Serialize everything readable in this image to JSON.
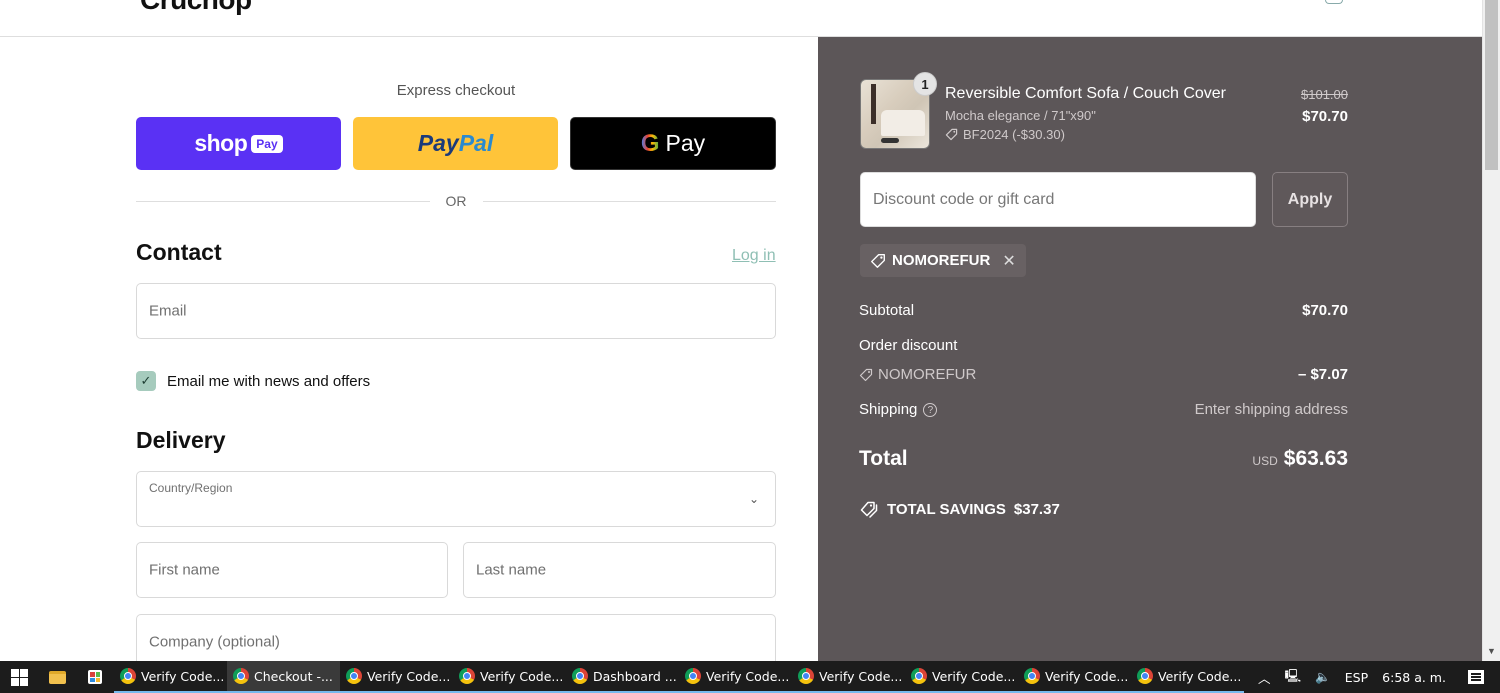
{
  "header": {
    "store_logo": "Cruchop"
  },
  "express_checkout": {
    "title": "Express checkout",
    "shop_pay": {
      "shop": "shop",
      "pay": "Pay"
    },
    "paypal": {
      "part1": "Pay",
      "part2": "Pal"
    },
    "gpay": {
      "g": "G",
      "pay": "Pay"
    },
    "divider": "OR"
  },
  "contact": {
    "title": "Contact",
    "login_link": "Log in",
    "email_placeholder": "Email",
    "newsletter_label": "Email me with news and offers",
    "newsletter_checked": true
  },
  "delivery": {
    "title": "Delivery",
    "country_label": "Country/Region",
    "country_value": "",
    "first_name_placeholder": "First name",
    "last_name_placeholder": "Last name",
    "company_placeholder": "Company (optional)"
  },
  "order_summary": {
    "product": {
      "quantity": "1",
      "name": "Reversible Comfort Sofa / Couch Cover",
      "variant": "Mocha elegance / 71\"x90\"",
      "discount": "BF2024 (-$30.30)",
      "original_price": "$101.00",
      "price": "$70.70"
    },
    "discount_placeholder": "Discount code or gift card",
    "apply_label": "Apply",
    "applied_code": "NOMOREFUR",
    "subtotal_label": "Subtotal",
    "subtotal_value": "$70.70",
    "order_discount_label": "Order discount",
    "order_discount_code": "NOMOREFUR",
    "order_discount_value": "– $7.07",
    "shipping_label": "Shipping",
    "shipping_value": "Enter shipping address",
    "total_label": "Total",
    "currency": "USD",
    "total_value": "$63.63",
    "savings_label": "TOTAL SAVINGS",
    "savings_value": "$37.37",
    "colors": {
      "panel_bg": "#5c5658",
      "accent_checkbox": "#a6cbbd"
    }
  },
  "taskbar": {
    "apps": [
      {
        "label": "Verify Code...",
        "active": false
      },
      {
        "label": "Checkout -...",
        "active": true
      },
      {
        "label": "Verify Code...",
        "active": false
      },
      {
        "label": "Verify Code...",
        "active": false
      },
      {
        "label": "Dashboard ...",
        "active": false
      },
      {
        "label": "Verify Code...",
        "active": false
      },
      {
        "label": "Verify Code...",
        "active": false
      },
      {
        "label": "Verify Code...",
        "active": false
      },
      {
        "label": "Verify Code...",
        "active": false
      },
      {
        "label": "Verify Code...",
        "active": false
      }
    ],
    "language": "ESP",
    "time": "6:58 a. m."
  }
}
